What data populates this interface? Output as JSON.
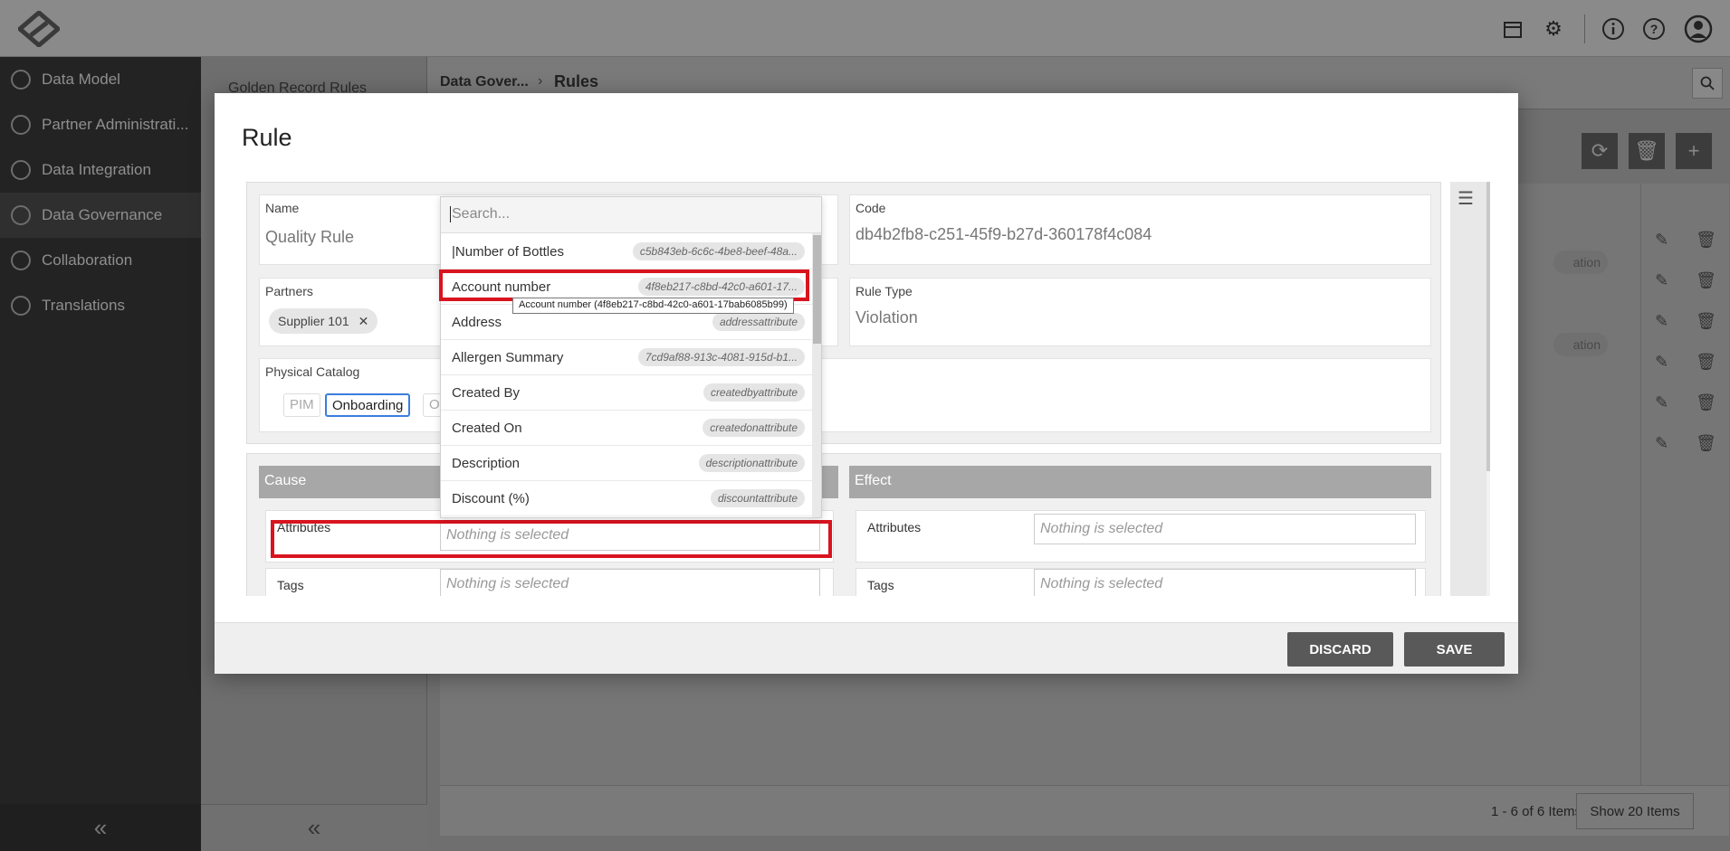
{
  "topbar": {
    "icons": [
      "logo-icon",
      "calendar-icon",
      "gear-icon",
      "info-icon",
      "help-icon",
      "user-avatar-icon"
    ]
  },
  "sidebar": {
    "items": [
      {
        "label": "Data Model",
        "icon": "data-model-icon"
      },
      {
        "label": "Partner Administrati...",
        "icon": "partner-admin-icon"
      },
      {
        "label": "Data Integration",
        "icon": "data-integration-icon"
      },
      {
        "label": "Data Governance",
        "icon": "data-governance-icon",
        "active": true
      },
      {
        "label": "Collaboration",
        "icon": "collaboration-icon"
      },
      {
        "label": "Translations",
        "icon": "translations-icon"
      }
    ],
    "collapse_glyph": "«"
  },
  "subpanel": {
    "title": "Golden Record Rules",
    "collapse_glyph": "«"
  },
  "main": {
    "breadcrumb": [
      "Data Gover...",
      "Rules"
    ],
    "breadcrumb_sep": "›",
    "row_badges": [
      "ation",
      "ation"
    ],
    "pager": {
      "summary": "1 - 6 of 6 Items",
      "page_size": "Show 20 Items"
    }
  },
  "modal": {
    "title": "Rule",
    "name_label": "Name",
    "name_value": "Quality Rule",
    "code_label": "Code",
    "code_value": "db4b2fb8-c251-45f9-b27d-360178f4c084",
    "partners_label": "Partners",
    "partner_chip": "Supplier 101",
    "rule_type_label": "Rule Type",
    "rule_type_value": "Violation",
    "catalog_label": "Physical Catalog",
    "catalog_options": [
      "PIM",
      "Onboarding",
      "Ot"
    ],
    "catalog_selected": "Onboarding",
    "cause": {
      "header": "Cause",
      "attributes_label": "Attributes",
      "attributes_placeholder": "Nothing is selected",
      "tags_label": "Tags",
      "tags_placeholder": "Nothing is selected"
    },
    "effect": {
      "header": "Effect",
      "attributes_label": "Attributes",
      "attributes_placeholder": "Nothing is selected",
      "tags_label": "Tags",
      "tags_placeholder": "Nothing is selected"
    },
    "dropdown": {
      "search_placeholder": "Search...",
      "items": [
        {
          "name": "|Number of Bottles",
          "code": "c5b843eb-6c6c-4be8-beef-48a..."
        },
        {
          "name": "Account number",
          "code": "4f8eb217-c8bd-42c0-a601-17..."
        },
        {
          "name": "Address",
          "code": "addressattribute"
        },
        {
          "name": "Allergen Summary",
          "code": "7cd9af88-913c-4081-915d-b1..."
        },
        {
          "name": "Created By",
          "code": "createdbyattribute"
        },
        {
          "name": "Created On",
          "code": "createdonattribute"
        },
        {
          "name": "Description",
          "code": "descriptionattribute"
        },
        {
          "name": "Discount (%)",
          "code": "discountattribute"
        }
      ],
      "tooltip": "Account number (4f8eb217-c8bd-42c0-a601-17bab6085b99)"
    },
    "discard_label": "DISCARD",
    "save_label": "SAVE"
  },
  "colors": {
    "highlight": "#d8141f",
    "primary_button": "#595959",
    "selected_outline": "#3b7ddd"
  }
}
